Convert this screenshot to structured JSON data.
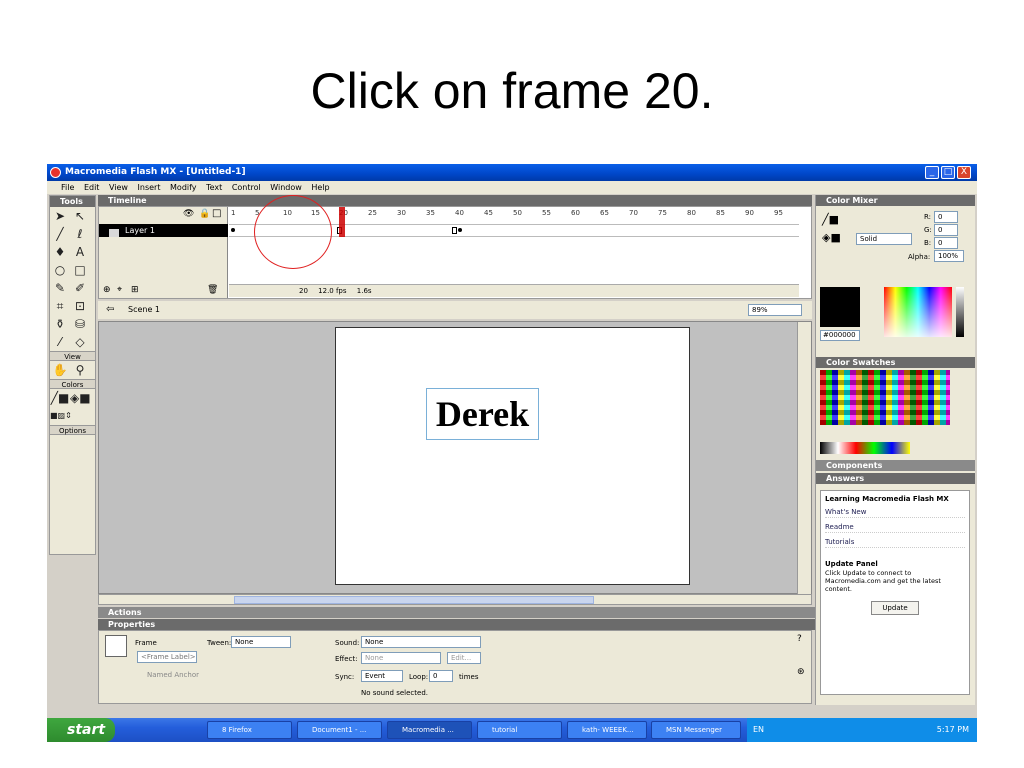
{
  "slide": {
    "title": "Click on frame 20."
  },
  "window": {
    "title": "Macromedia Flash MX - [Untitled-1]",
    "min": "_",
    "max": "□",
    "close": "X"
  },
  "menu": [
    "File",
    "Edit",
    "View",
    "Insert",
    "Modify",
    "Text",
    "Control",
    "Window",
    "Help"
  ],
  "tools": {
    "header": "Tools",
    "view": "View",
    "colors": "Colors",
    "options": "Options"
  },
  "timeline": {
    "header": "Timeline",
    "frame_numbers": [
      "1",
      "5",
      "10",
      "15",
      "20",
      "25",
      "30",
      "35",
      "40",
      "45",
      "50",
      "55",
      "60",
      "65",
      "70",
      "75",
      "80",
      "85",
      "90",
      "95"
    ],
    "layer_name": "Layer 1",
    "current_frame": "20",
    "fps": "12.0 fps",
    "time": "1.6s"
  },
  "scene": {
    "name": "Scene 1",
    "zoom": "89%"
  },
  "stage": {
    "text": "Derek"
  },
  "panels": {
    "actions": "Actions",
    "properties": "Properties"
  },
  "properties": {
    "frame_label": "Frame",
    "frame_placeholder": "<Frame Label>",
    "named_anchor": "Named Anchor",
    "tween_label": "Tween:",
    "tween_value": "None",
    "sound_label": "Sound:",
    "sound_value": "None",
    "effect_label": "Effect:",
    "effect_value": "None",
    "edit": "Edit...",
    "sync_label": "Sync:",
    "sync_value": "Event",
    "loop_label": "Loop:",
    "loop_value": "0",
    "times": "times",
    "no_sound": "No sound selected."
  },
  "color_mixer": {
    "header": "Color Mixer",
    "fill_type": "Solid",
    "r_label": "R:",
    "r": "0",
    "g_label": "G:",
    "g": "0",
    "b_label": "B:",
    "b": "0",
    "alpha_label": "Alpha:",
    "alpha": "100%",
    "hex": "#000000"
  },
  "color_swatches": {
    "header": "Color Swatches"
  },
  "components": {
    "header": "Components"
  },
  "answers": {
    "header": "Answers",
    "title": "Learning Macromedia Flash MX",
    "links": [
      "What's New",
      "Readme",
      "Tutorials"
    ],
    "update_title": "Update Panel",
    "update_text": "Click Update to connect to Macromedia.com and get the latest content.",
    "update_button": "Update"
  },
  "taskbar": {
    "start": "start",
    "items": [
      "8 Firefox",
      "Document1 - ...",
      "Macromedia ...",
      "tutorial",
      "kath- WEEEK...",
      "MSN Messenger"
    ],
    "lang": "EN",
    "clock": "5:17 PM"
  }
}
